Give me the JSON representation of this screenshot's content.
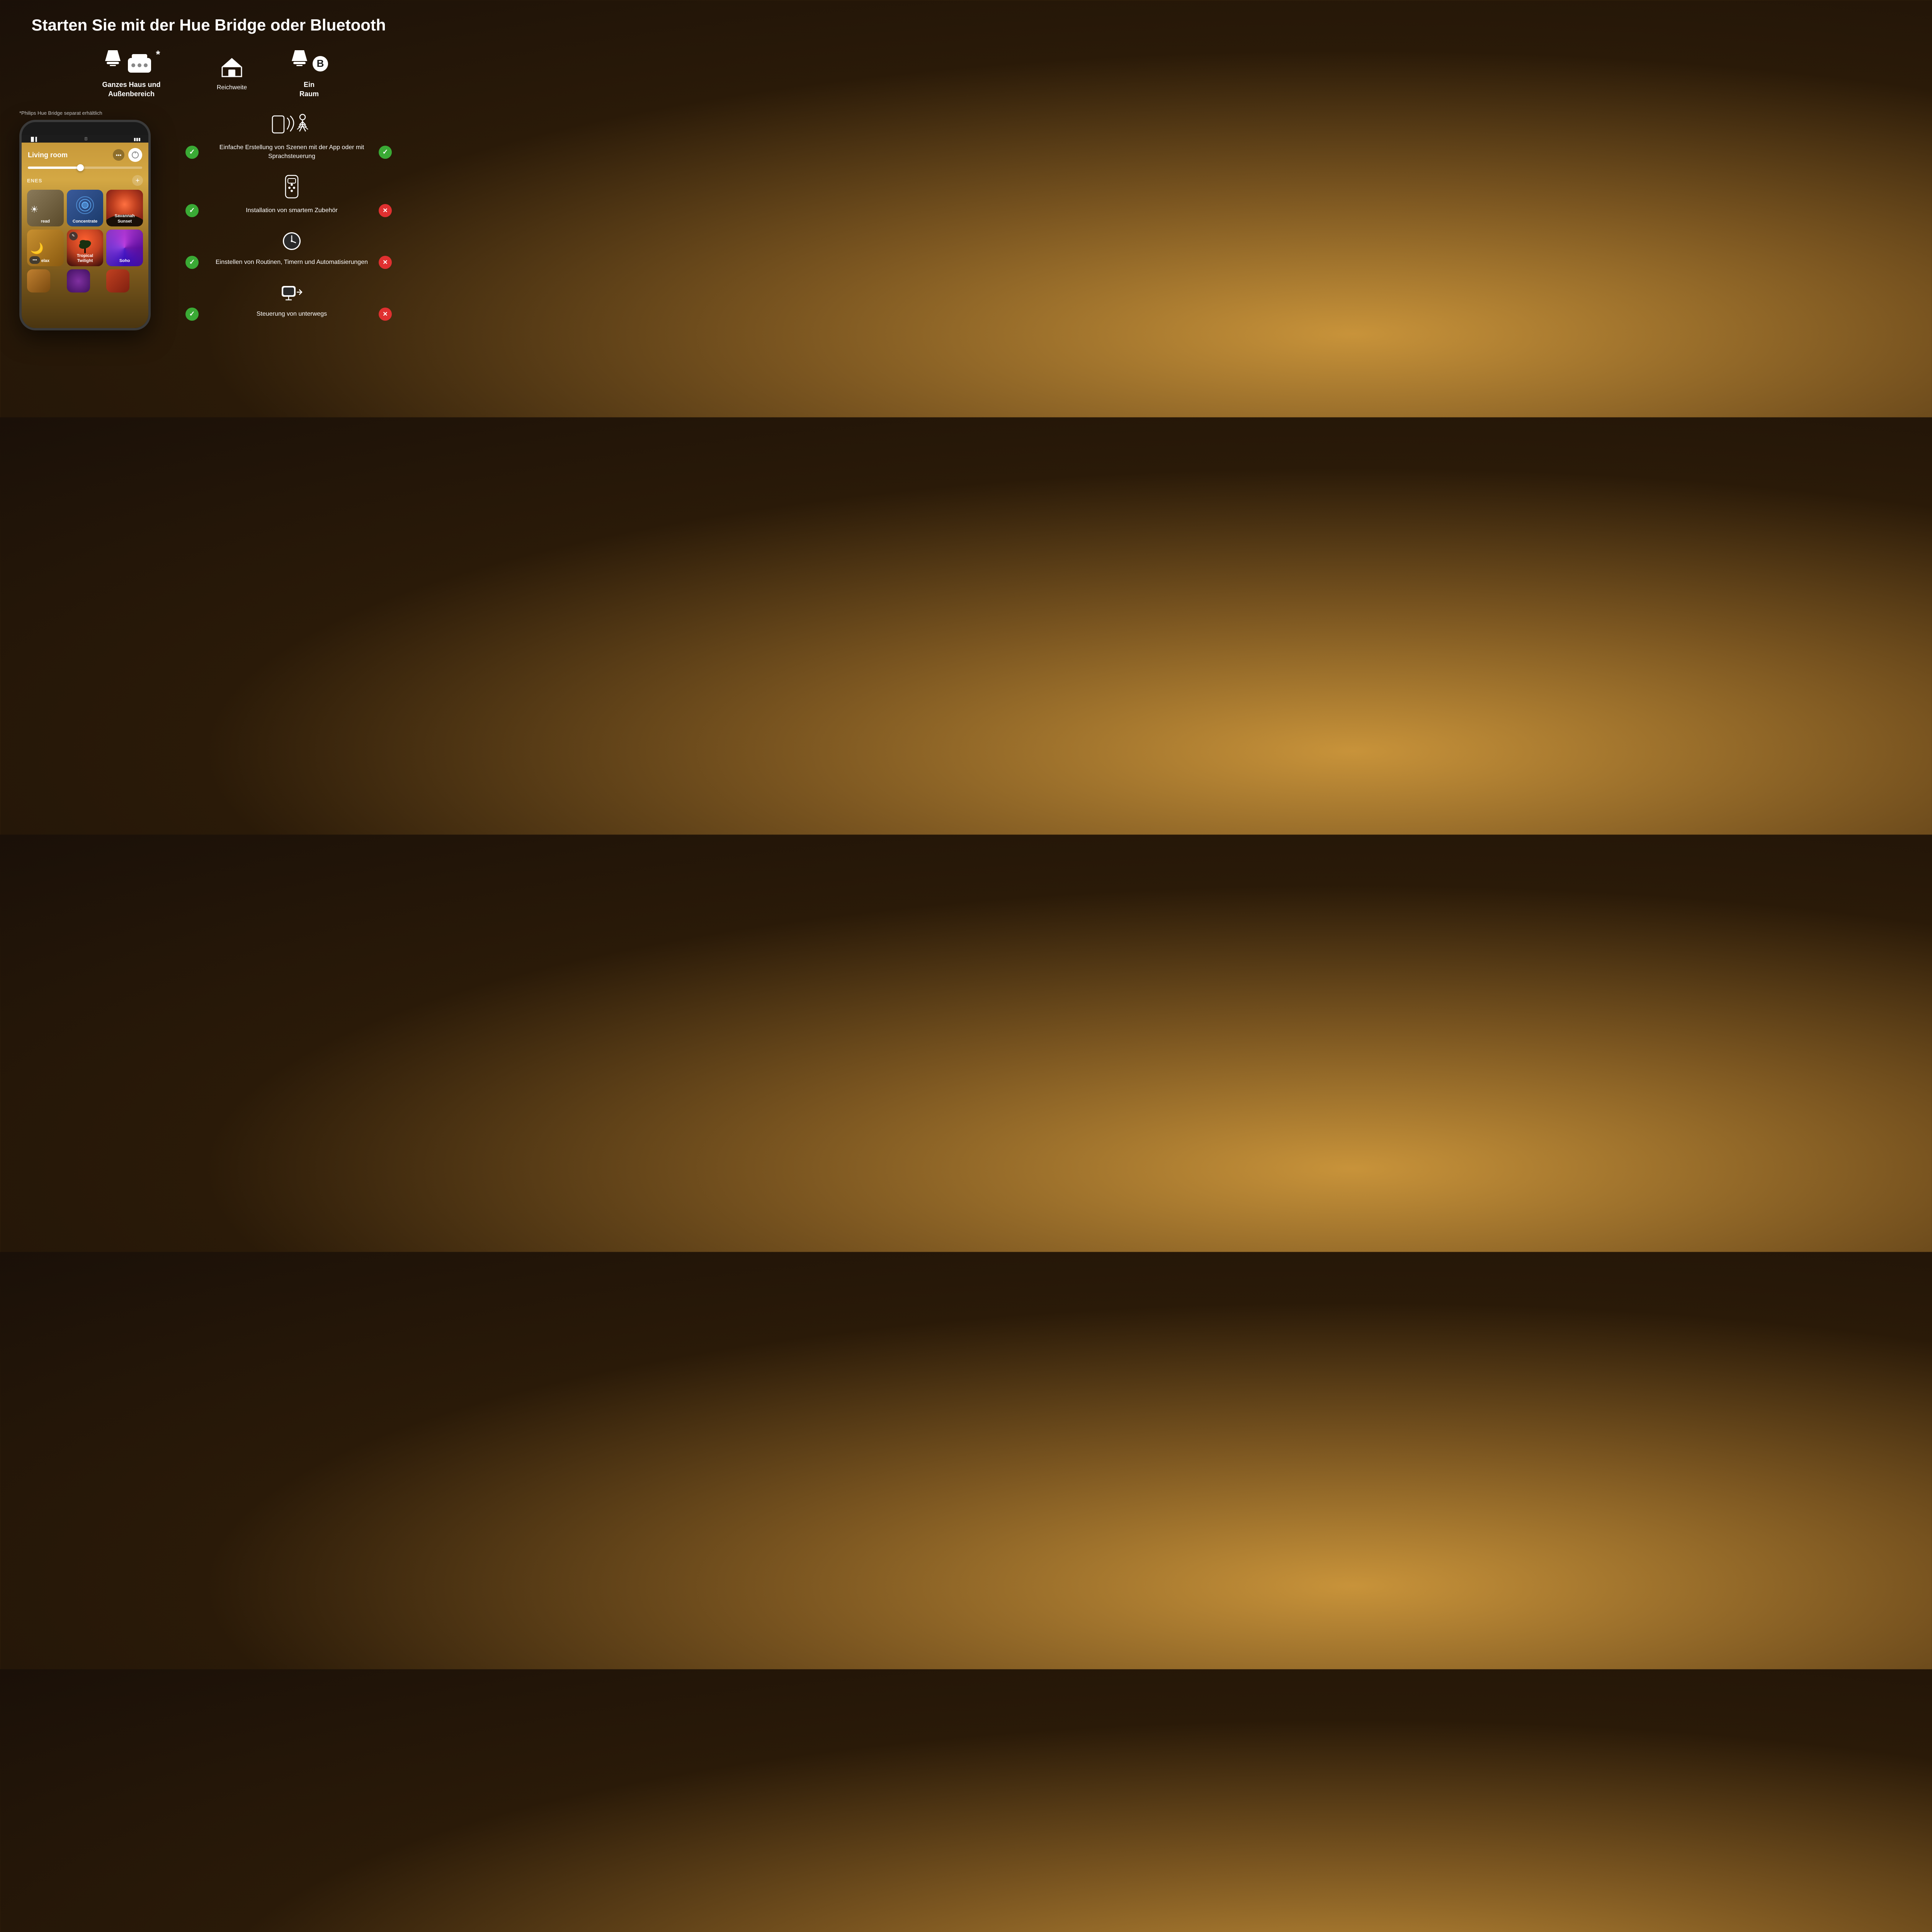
{
  "title": "Starten Sie mit der Hue Bridge oder Bluetooth",
  "bridge_column": {
    "label_line1": "Ganzes Haus und",
    "label_line2": "Außenbereich"
  },
  "range_column": {
    "label": "Reichweite"
  },
  "bluetooth_column": {
    "label_line1": "Ein",
    "label_line2": "Raum"
  },
  "footnote": "*Philips Hue Bridge separat erhältlich",
  "features": [
    {
      "id": "scenes",
      "text": "Einfache Erstellung von Szenen mit der App oder mit Sprachsteuerung",
      "bridge": true,
      "bluetooth": true,
      "icon": "nfc"
    },
    {
      "id": "accessories",
      "text": "Installation von smartem Zubehör",
      "bridge": true,
      "bluetooth": false,
      "icon": "remote"
    },
    {
      "id": "routines",
      "text": "Einstellen von Routinen, Timern und Automatisierungen",
      "bridge": true,
      "bluetooth": false,
      "icon": "clock"
    },
    {
      "id": "remote",
      "text": "Steuerung von unterwegs",
      "bridge": true,
      "bluetooth": false,
      "icon": "remote-access"
    }
  ],
  "phone": {
    "room_title": "Living room",
    "scenes_label": "ENES",
    "scenes": [
      {
        "id": "read",
        "label": "read",
        "color_start": "#8a7a5a",
        "color_end": "#5a4a2a",
        "icon": "☀"
      },
      {
        "id": "concentrate",
        "label": "Concentrate",
        "color_start": "#5a7aaa",
        "color_end": "#3a5a8a",
        "icon": "◎",
        "has_circle": true
      },
      {
        "id": "savannah",
        "label": "Savannah Sunset",
        "color_start": "#c85020",
        "color_end": "#8a3010",
        "has_image": true
      },
      {
        "id": "relax",
        "label": "elax",
        "color_start": "#c89030",
        "color_end": "#8a5a10",
        "icon": "🌙"
      },
      {
        "id": "tropical",
        "label": "Tropical Twilight",
        "color_start": "#d05030",
        "color_end": "#602010",
        "has_image": true,
        "has_edit": true
      },
      {
        "id": "soho",
        "label": "Soho",
        "color_start": "#8030a0",
        "color_end": "#501070",
        "has_image": true
      }
    ],
    "bottom_scenes": [
      {
        "id": "b1",
        "label": "",
        "color_start": "#c08030",
        "color_end": "#7a4a10"
      },
      {
        "id": "b2",
        "label": "",
        "color_start": "#704080",
        "color_end": "#402060"
      },
      {
        "id": "b3",
        "label": "",
        "color_start": "#c04020",
        "color_end": "#802010"
      }
    ]
  }
}
